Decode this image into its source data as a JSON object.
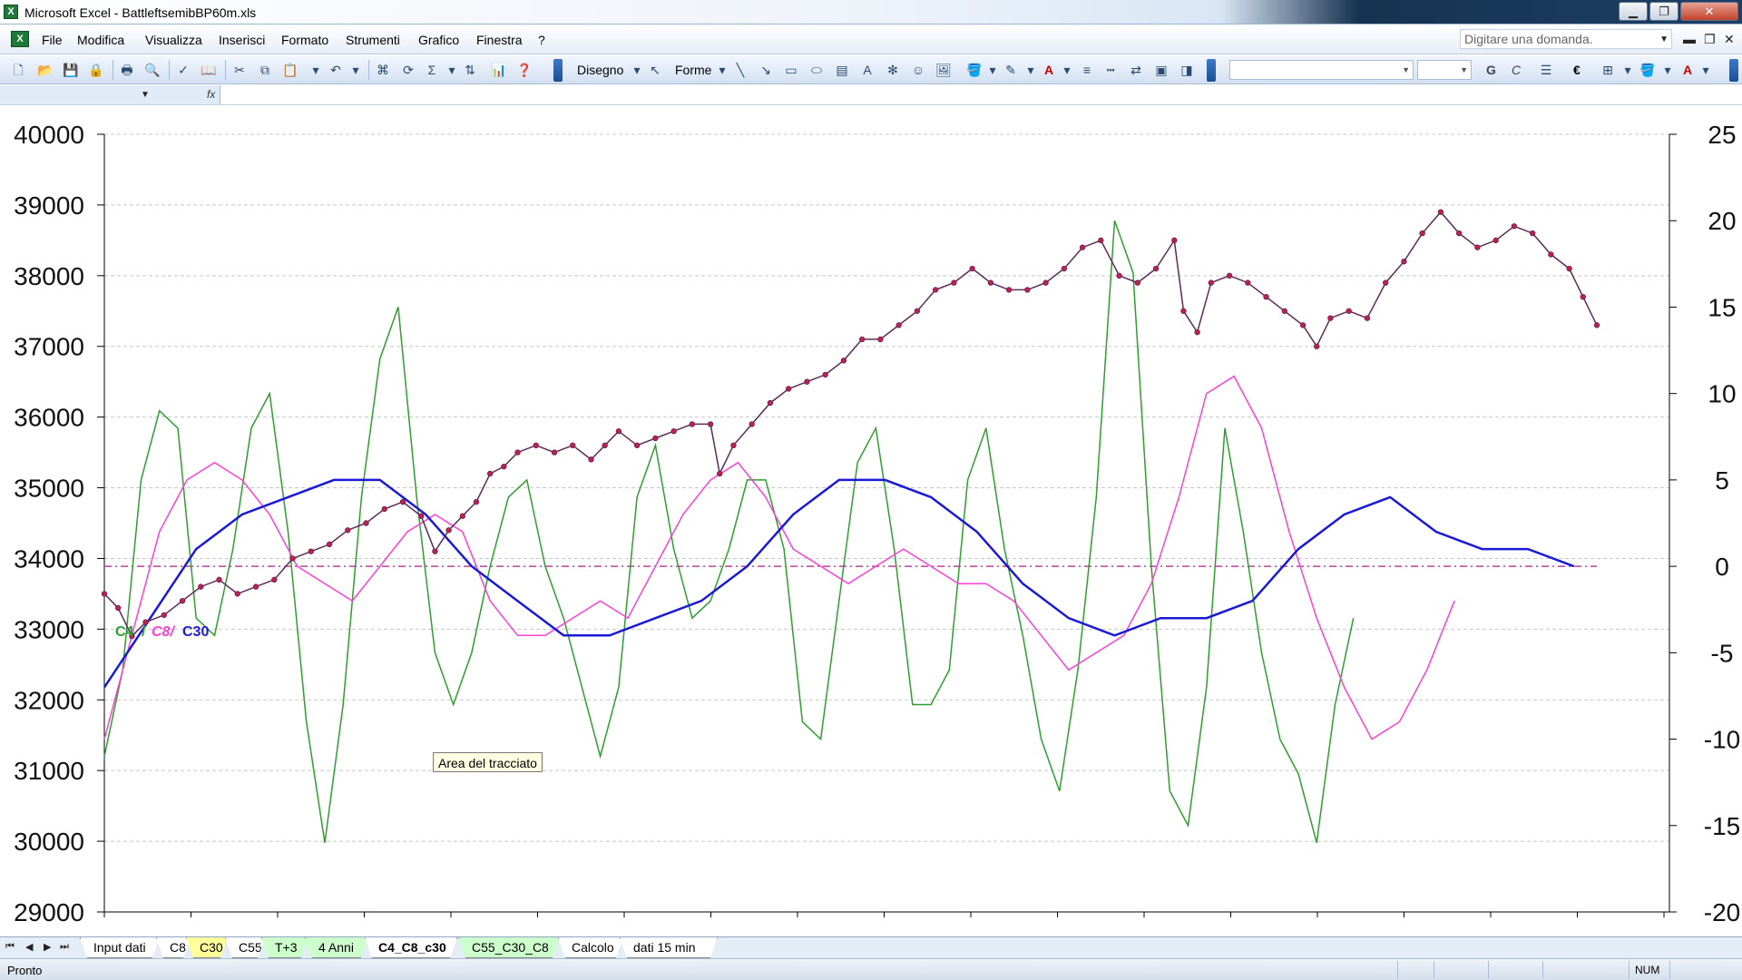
{
  "window": {
    "title": "Microsoft Excel - BattleftsemibBP60m.xls",
    "app_icon": "excel-icon"
  },
  "menu": {
    "items": [
      "File",
      "Modifica",
      "Visualizza",
      "Inserisci",
      "Formato",
      "Strumenti",
      "Grafico",
      "Finestra",
      "?"
    ],
    "question_placeholder": "Digitare una domanda."
  },
  "toolbar": {
    "drawing_label": "Disegno",
    "shapes_label": "Forme",
    "bold": "G",
    "italic": "C",
    "currency": "€"
  },
  "formula_bar": {
    "fx": "fx"
  },
  "chart": {
    "left_axis_ticks": [
      "40000",
      "39000",
      "38000",
      "37000",
      "36000",
      "35000",
      "34000",
      "33000",
      "32000",
      "31000",
      "30000",
      "29000"
    ],
    "right_axis_ticks": [
      "25",
      "20",
      "15",
      "10",
      "5",
      "0",
      "-5",
      "-10",
      "-15",
      "-20"
    ],
    "legend": {
      "c4": "C4",
      "sep1": "/",
      "c8": "C8/",
      "c30": "C30"
    },
    "tooltip": "Area del tracciato",
    "colors": {
      "price": "#5c2a5c",
      "marker": "#c41e4a",
      "c4": "#2e9e2e",
      "c8": "#ff3fd6",
      "c30": "#1a1ad6",
      "zero_line": "#c0409a"
    }
  },
  "chart_data": {
    "type": "line",
    "left_axis": {
      "ylim": [
        29000,
        40000
      ],
      "major": 1000
    },
    "right_axis": {
      "ylim": [
        -20,
        25
      ],
      "major": 5
    },
    "grid": true,
    "series": [
      {
        "name": "price",
        "axis": "left",
        "points": [
          [
            0,
            33500
          ],
          [
            3,
            33300
          ],
          [
            6,
            32900
          ],
          [
            9,
            33100
          ],
          [
            13,
            33200
          ],
          [
            17,
            33400
          ],
          [
            21,
            33600
          ],
          [
            25,
            33700
          ],
          [
            29,
            33500
          ],
          [
            33,
            33600
          ],
          [
            37,
            33700
          ],
          [
            41,
            34000
          ],
          [
            45,
            34100
          ],
          [
            49,
            34200
          ],
          [
            53,
            34400
          ],
          [
            57,
            34500
          ],
          [
            61,
            34700
          ],
          [
            65,
            34800
          ],
          [
            69,
            34600
          ],
          [
            72,
            34100
          ],
          [
            75,
            34400
          ],
          [
            78,
            34600
          ],
          [
            81,
            34800
          ],
          [
            84,
            35200
          ],
          [
            87,
            35300
          ],
          [
            90,
            35500
          ],
          [
            94,
            35600
          ],
          [
            98,
            35500
          ],
          [
            102,
            35600
          ],
          [
            106,
            35400
          ],
          [
            109,
            35600
          ],
          [
            112,
            35800
          ],
          [
            116,
            35600
          ],
          [
            120,
            35700
          ],
          [
            124,
            35800
          ],
          [
            128,
            35900
          ],
          [
            132,
            35900
          ],
          [
            134,
            35200
          ],
          [
            137,
            35600
          ],
          [
            141,
            35900
          ],
          [
            145,
            36200
          ],
          [
            149,
            36400
          ],
          [
            153,
            36500
          ],
          [
            157,
            36600
          ],
          [
            161,
            36800
          ],
          [
            165,
            37100
          ],
          [
            169,
            37100
          ],
          [
            173,
            37300
          ],
          [
            177,
            37500
          ],
          [
            181,
            37800
          ],
          [
            185,
            37900
          ],
          [
            189,
            38100
          ],
          [
            193,
            37900
          ],
          [
            197,
            37800
          ],
          [
            201,
            37800
          ],
          [
            205,
            37900
          ],
          [
            209,
            38100
          ],
          [
            213,
            38400
          ],
          [
            217,
            38500
          ],
          [
            221,
            38000
          ],
          [
            225,
            37900
          ],
          [
            229,
            38100
          ],
          [
            233,
            38500
          ],
          [
            235,
            37500
          ],
          [
            238,
            37200
          ],
          [
            241,
            37900
          ],
          [
            245,
            38000
          ],
          [
            249,
            37900
          ],
          [
            253,
            37700
          ],
          [
            257,
            37500
          ],
          [
            261,
            37300
          ],
          [
            264,
            37000
          ],
          [
            267,
            37400
          ],
          [
            271,
            37500
          ],
          [
            275,
            37400
          ],
          [
            279,
            37900
          ],
          [
            283,
            38200
          ],
          [
            287,
            38600
          ],
          [
            291,
            38900
          ],
          [
            295,
            38600
          ],
          [
            299,
            38400
          ],
          [
            303,
            38500
          ],
          [
            307,
            38700
          ],
          [
            311,
            38600
          ],
          [
            315,
            38300
          ],
          [
            319,
            38100
          ],
          [
            322,
            37700
          ],
          [
            325,
            37300
          ]
        ]
      },
      {
        "name": "C4",
        "axis": "right",
        "points": [
          [
            0,
            -11
          ],
          [
            4,
            -6
          ],
          [
            8,
            5
          ],
          [
            12,
            9
          ],
          [
            16,
            8
          ],
          [
            20,
            -3
          ],
          [
            24,
            -4
          ],
          [
            28,
            1
          ],
          [
            32,
            8
          ],
          [
            36,
            10
          ],
          [
            40,
            2
          ],
          [
            44,
            -9
          ],
          [
            48,
            -16
          ],
          [
            52,
            -8
          ],
          [
            56,
            4
          ],
          [
            60,
            12
          ],
          [
            64,
            15
          ],
          [
            68,
            4
          ],
          [
            72,
            -5
          ],
          [
            76,
            -8
          ],
          [
            80,
            -5
          ],
          [
            84,
            0
          ],
          [
            88,
            4
          ],
          [
            92,
            5
          ],
          [
            96,
            0
          ],
          [
            100,
            -3
          ],
          [
            104,
            -7
          ],
          [
            108,
            -11
          ],
          [
            112,
            -7
          ],
          [
            116,
            4
          ],
          [
            120,
            7
          ],
          [
            124,
            1
          ],
          [
            128,
            -3
          ],
          [
            132,
            -2
          ],
          [
            136,
            1
          ],
          [
            140,
            5
          ],
          [
            144,
            5
          ],
          [
            148,
            1
          ],
          [
            152,
            -9
          ],
          [
            156,
            -10
          ],
          [
            160,
            -2
          ],
          [
            164,
            6
          ],
          [
            168,
            8
          ],
          [
            172,
            1
          ],
          [
            176,
            -8
          ],
          [
            180,
            -8
          ],
          [
            184,
            -6
          ],
          [
            188,
            5
          ],
          [
            192,
            8
          ],
          [
            196,
            1
          ],
          [
            200,
            -4
          ],
          [
            204,
            -10
          ],
          [
            208,
            -13
          ],
          [
            212,
            -6
          ],
          [
            216,
            4
          ],
          [
            220,
            20
          ],
          [
            224,
            17
          ],
          [
            228,
            0
          ],
          [
            232,
            -13
          ],
          [
            236,
            -15
          ],
          [
            240,
            -7
          ],
          [
            244,
            8
          ],
          [
            248,
            2
          ],
          [
            252,
            -5
          ],
          [
            256,
            -10
          ],
          [
            260,
            -12
          ],
          [
            264,
            -16
          ],
          [
            268,
            -8
          ],
          [
            272,
            -3
          ]
        ]
      },
      {
        "name": "C8",
        "axis": "right",
        "points": [
          [
            0,
            -10
          ],
          [
            6,
            -4
          ],
          [
            12,
            2
          ],
          [
            18,
            5
          ],
          [
            24,
            6
          ],
          [
            30,
            5
          ],
          [
            36,
            3
          ],
          [
            42,
            0
          ],
          [
            48,
            -1
          ],
          [
            54,
            -2
          ],
          [
            60,
            0
          ],
          [
            66,
            2
          ],
          [
            72,
            3
          ],
          [
            78,
            2
          ],
          [
            84,
            -2
          ],
          [
            90,
            -4
          ],
          [
            96,
            -4
          ],
          [
            102,
            -3
          ],
          [
            108,
            -2
          ],
          [
            114,
            -3
          ],
          [
            120,
            0
          ],
          [
            126,
            3
          ],
          [
            132,
            5
          ],
          [
            138,
            6
          ],
          [
            144,
            4
          ],
          [
            150,
            1
          ],
          [
            156,
            0
          ],
          [
            162,
            -1
          ],
          [
            168,
            0
          ],
          [
            174,
            1
          ],
          [
            180,
            0
          ],
          [
            186,
            -1
          ],
          [
            192,
            -1
          ],
          [
            198,
            -2
          ],
          [
            204,
            -4
          ],
          [
            210,
            -6
          ],
          [
            216,
            -5
          ],
          [
            222,
            -4
          ],
          [
            228,
            -1
          ],
          [
            234,
            4
          ],
          [
            240,
            10
          ],
          [
            246,
            11
          ],
          [
            252,
            8
          ],
          [
            258,
            2
          ],
          [
            264,
            -3
          ],
          [
            270,
            -7
          ],
          [
            276,
            -10
          ],
          [
            282,
            -9
          ],
          [
            288,
            -6
          ],
          [
            294,
            -2
          ]
        ]
      },
      {
        "name": "C30",
        "axis": "right",
        "points": [
          [
            0,
            -7
          ],
          [
            10,
            -3
          ],
          [
            20,
            1
          ],
          [
            30,
            3
          ],
          [
            40,
            4
          ],
          [
            50,
            5
          ],
          [
            60,
            5
          ],
          [
            70,
            3
          ],
          [
            80,
            0
          ],
          [
            90,
            -2
          ],
          [
            100,
            -4
          ],
          [
            110,
            -4
          ],
          [
            120,
            -3
          ],
          [
            130,
            -2
          ],
          [
            140,
            0
          ],
          [
            150,
            3
          ],
          [
            160,
            5
          ],
          [
            170,
            5
          ],
          [
            180,
            4
          ],
          [
            190,
            2
          ],
          [
            200,
            -1
          ],
          [
            210,
            -3
          ],
          [
            220,
            -4
          ],
          [
            230,
            -3
          ],
          [
            240,
            -3
          ],
          [
            250,
            -2
          ],
          [
            260,
            1
          ],
          [
            270,
            3
          ],
          [
            280,
            4
          ],
          [
            290,
            2
          ],
          [
            300,
            1
          ],
          [
            310,
            1
          ],
          [
            320,
            0
          ]
        ]
      },
      {
        "name": "zero",
        "axis": "right",
        "points": [
          [
            0,
            0
          ],
          [
            325,
            0
          ]
        ]
      }
    ]
  },
  "sheets": {
    "tabs": [
      {
        "label": "Input dati",
        "color": "#ffffff"
      },
      {
        "label": "C8",
        "color": "#ffffff"
      },
      {
        "label": "C30",
        "color": "#ffff99"
      },
      {
        "label": "C55",
        "color": "#ffffff"
      },
      {
        "label": "T+3",
        "color": "#ccffcc"
      },
      {
        "label": "4 Anni",
        "color": "#ccffcc"
      },
      {
        "label": "C4_C8_c30",
        "color": "#ffffff"
      },
      {
        "label": "C55_C30_C8",
        "color": "#ccffcc"
      },
      {
        "label": "Calcolo",
        "color": "#ffffff"
      },
      {
        "label": "dati 15 min",
        "color": "#ffffff"
      }
    ],
    "active": "C4_C8_c30"
  },
  "status": {
    "text": "Pronto",
    "num": "NUM"
  }
}
